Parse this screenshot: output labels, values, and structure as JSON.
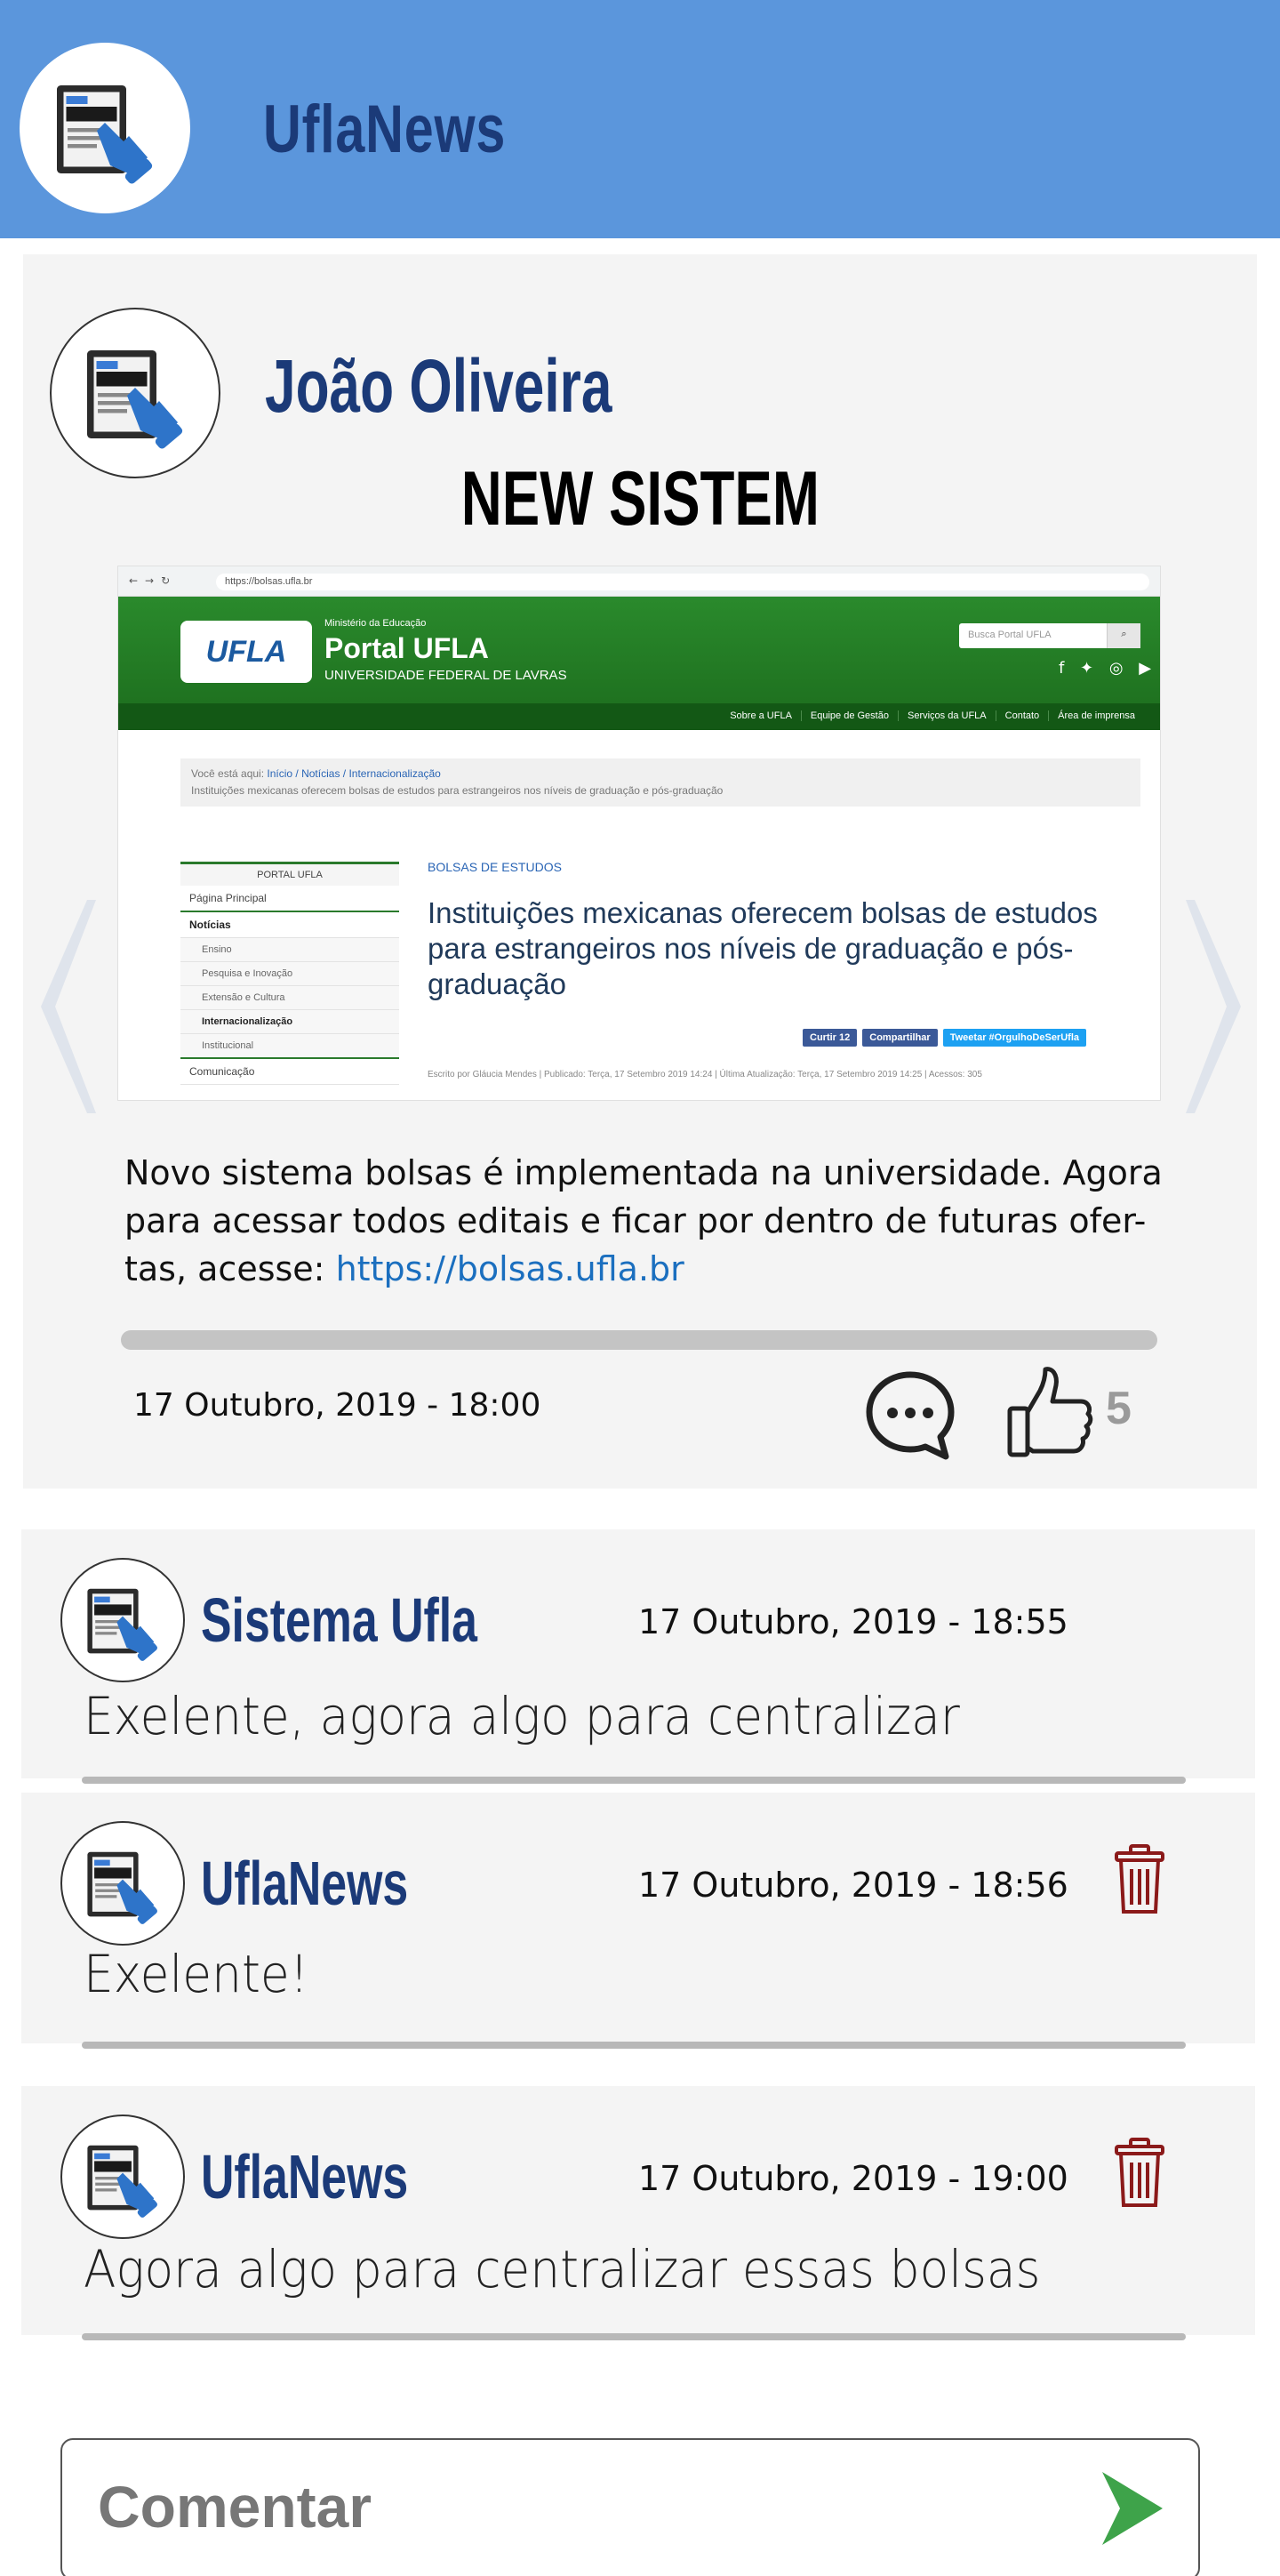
{
  "header": {
    "app_title": "UflaNews",
    "logo_text": "NEWS",
    "logo_small": "UFLA"
  },
  "post": {
    "author": "João Oliveira",
    "title": "NEW SISTEM",
    "image": {
      "url": "https://bolsas.ufla.br",
      "ministry": "Ministério da Educação",
      "portal_name": "Portal UFLA",
      "portal_sub": "UNIVERSIDADE FEDERAL DE LAVRAS",
      "logo_word": "UFLA",
      "search_placeholder": "Busca Portal UFLA",
      "menu": [
        "Sobre a UFLA",
        "Equipe de Gestão",
        "Serviços da UFLA",
        "Contato",
        "Área de imprensa"
      ],
      "breadcrumb_lead": "Você está aqui:",
      "breadcrumb_links": "Início / Notícias / Internacionalização",
      "breadcrumb_last": "Instituições mexicanas oferecem bolsas de estudos para estrangeiros nos níveis de graduação e pós-graduação",
      "side_menu": [
        "PORTAL UFLA",
        "Página Principal",
        "Notícias",
        "Ensino",
        "Pesquisa e Inovação",
        "Extensão e Cultura",
        "Internacionalização",
        "Institucional",
        "Comunicação"
      ],
      "category": "BOLSAS DE ESTUDOS",
      "article_title": "Instituições mexicanas oferecem bolsas de estudos para estrangeiros nos níveis de graduação e pós-graduação",
      "share": [
        "Curtir 12",
        "Compartilhar",
        "Tweetar #OrgulhoDeSerUfla"
      ],
      "meta": "Escrito por Gláucia Mendes | Publicado: Terça, 17 Setembro 2019 14:24 | Última Atualização: Terça, 17 Setembro 2019 14:25 | Acessos: 305"
    },
    "body_text": "Novo sistema bolsas é implementada na universidade. Agora para acessar todos editais e ficar por dentro de futuras ofer-tas, acesse: ",
    "body_link": "https://bolsas.ufla.br",
    "date": "17 Outubro, 2019 - 18:00",
    "likes": "5"
  },
  "comments": [
    {
      "author": "Sistema Ufla",
      "date": "17 Outubro, 2019 - 18:55",
      "text": "Exelente, agora algo para centralizar"
    },
    {
      "author": "UflaNews",
      "date": "17 Outubro, 2019 - 18:56",
      "text": "Exelente!"
    },
    {
      "author": "UflaNews",
      "date": "17 Outubro, 2019 - 19:00",
      "text": "Agora algo para centralizar essas bolsas"
    }
  ],
  "comment_input": {
    "placeholder": "Comentar"
  },
  "colors": {
    "header_bg": "#5b96dc",
    "brand_blue": "#1b3a78",
    "link": "#1b6fbf",
    "delete_red": "#8b1a1a",
    "send_green": "#3ea34a"
  },
  "icons": [
    "newspaper-hand-icon",
    "chevron-left-icon",
    "chevron-right-icon",
    "comment-bubble-icon",
    "thumbs-up-icon",
    "trash-icon",
    "send-arrow-icon"
  ]
}
